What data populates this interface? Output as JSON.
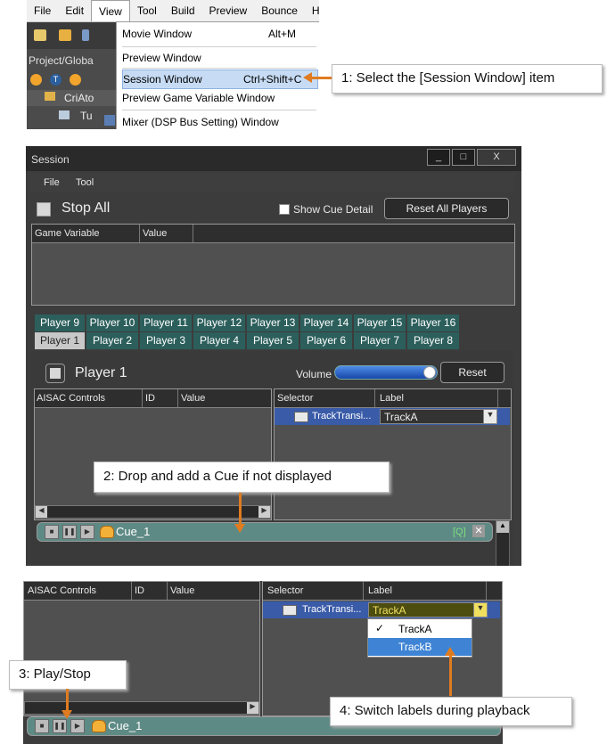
{
  "menu_panel": {
    "menubar": [
      "File",
      "Edit",
      "View",
      "Tool",
      "Build",
      "Preview",
      "Bounce",
      "H"
    ],
    "active_menu": "View",
    "left_pane_label": "Project/Globa",
    "tree_items": [
      "CriAto",
      "Tu",
      ""
    ],
    "dropdown_items": [
      {
        "label": "Movie Window",
        "shortcut": "Alt+M"
      },
      {
        "label": "Preview Window",
        "shortcut": ""
      },
      {
        "label": "Session Window",
        "shortcut": "Ctrl+Shift+C"
      },
      {
        "label": "Preview Game Variable Window",
        "shortcut": ""
      },
      {
        "label": "Mixer (DSP Bus Setting) Window",
        "shortcut": ""
      }
    ],
    "highlighted_item": "Session Window"
  },
  "callouts": {
    "c1": "1:  Select the [Session Window] item",
    "c2": "2:  Drop and add a Cue if not displayed",
    "c3": "3:  Play/Stop",
    "c4": "4:  Switch labels during playback"
  },
  "session": {
    "title": "Session",
    "window_buttons": [
      "_",
      "□",
      "X"
    ],
    "menu": [
      "File",
      "Tool"
    ],
    "stop_all": "Stop All",
    "show_cue_detail": "Show Cue Detail",
    "reset_all_players": "Reset All Players",
    "game_var_headers": [
      "Game Variable",
      "Value"
    ],
    "player_tabs_row1": [
      "Player 9",
      "Player 10",
      "Player 11",
      "Player 12",
      "Player 13",
      "Player 14",
      "Player 15",
      "Player 16"
    ],
    "player_tabs_row2": [
      "Player 1",
      "Player 2",
      "Player 3",
      "Player 4",
      "Player 5",
      "Player 6",
      "Player 7",
      "Player 8"
    ],
    "selected_tab": "Player 1",
    "player_title": "Player 1",
    "volume_label": "Volume",
    "volume_level": 0.95,
    "reset": "Reset",
    "aisac_headers": [
      "AISAC Controls",
      "ID",
      "Value"
    ],
    "selector_headers": [
      "Selector",
      "Label"
    ],
    "selector_row": {
      "selector": "TrackTransi...",
      "label": "TrackA"
    },
    "cue_name": "Cue_1",
    "q_marker": "[Q]"
  },
  "panel3": {
    "aisac_headers": [
      "AISAC Controls",
      "ID",
      "Value"
    ],
    "selector_headers": [
      "Selector",
      "Label"
    ],
    "selector_row": {
      "selector": "TrackTransi...",
      "label": "TrackA"
    },
    "dropdown_options": [
      "TrackA",
      "TrackB"
    ],
    "checked_option": "TrackA",
    "highlighted_option": "TrackB",
    "cue_name": "Cue_1"
  },
  "colors": {
    "accent_arrow": "#e07b20",
    "tab_teal": "#2c5f5c",
    "selection_blue": "#3f84d4"
  }
}
